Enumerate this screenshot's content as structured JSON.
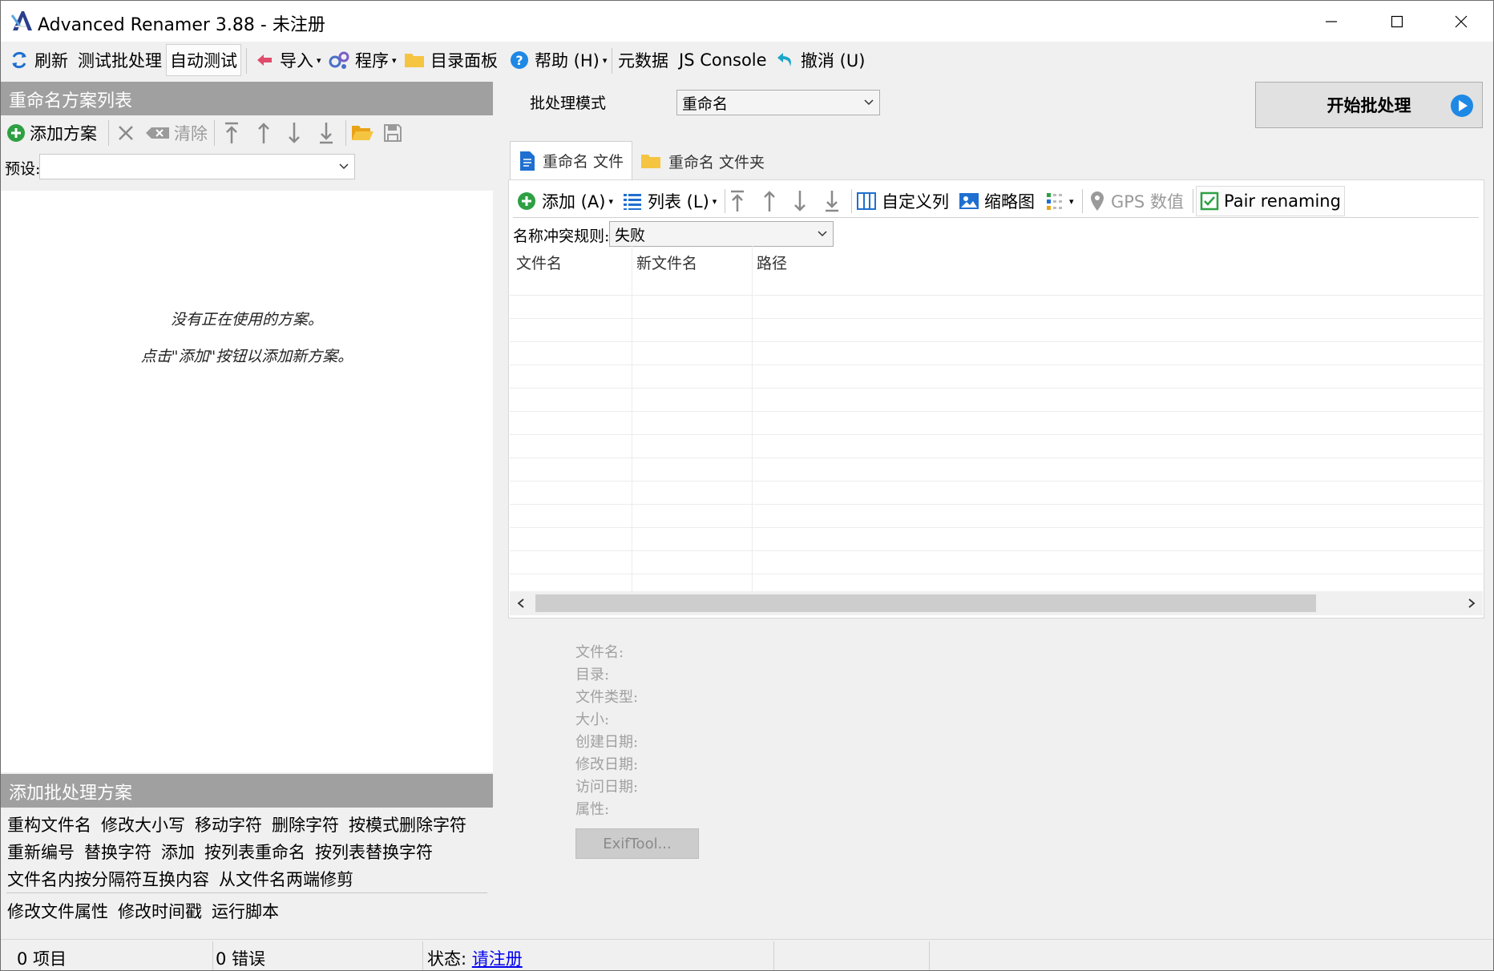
{
  "window": {
    "title": "Advanced Renamer 3.88 - 未注册"
  },
  "toolbar": {
    "refresh": "刷新",
    "test_batch": "测试批处理",
    "auto_test": "自动测试",
    "import": "导入",
    "program": "程序",
    "dir_panel": "目录面板",
    "help": "帮助 (H)",
    "metadata": "元数据",
    "js_console": "JS Console",
    "undo": "撤消 (U)"
  },
  "left": {
    "method_list_header": "重命名方案列表",
    "add_method": "添加方案",
    "clear": "清除",
    "preset_label": "预设:",
    "preset_value": "",
    "empty_line1": "没有正在使用的方案。",
    "empty_line2": "点击\"添加\"按钮以添加新方案。",
    "add_batch_header": "添加批处理方案",
    "methods_row1": [
      "重构文件名",
      "修改大小写",
      "移动字符",
      "删除字符",
      "按模式删除字符"
    ],
    "methods_row2": [
      "重新编号",
      "替换字符",
      "添加",
      "按列表重命名",
      "按列表替换字符"
    ],
    "methods_row3": [
      "文件名内按分隔符互换内容",
      "从文件名两端修剪"
    ],
    "methods_row4": [
      "修改文件属性",
      "修改时间戳",
      "运行脚本"
    ]
  },
  "batch": {
    "mode_label": "批处理模式",
    "mode_value": "重命名",
    "start_button": "开始批处理"
  },
  "tabs": {
    "files": "重命名 文件",
    "folders": "重命名 文件夹"
  },
  "files_toolbar": {
    "add": "添加 (A)",
    "list": "列表 (L)",
    "custom_columns": "自定义列",
    "thumbnail": "缩略图",
    "gps": "GPS 数值",
    "pair_renaming": "Pair renaming"
  },
  "conflict": {
    "label": "名称冲突规则:",
    "value": "失败"
  },
  "columns": [
    "文件名",
    "新文件名",
    "路径"
  ],
  "file_info": {
    "filename": "文件名:",
    "directory": "目录:",
    "filetype": "文件类型:",
    "size": "大小:",
    "created": "创建日期:",
    "modified": "修改日期:",
    "accessed": "访问日期:",
    "attributes": "属性:",
    "exiftool": "ExifTool..."
  },
  "status": {
    "items": "0 项目",
    "errors": "0 错误",
    "state_label": "状态:",
    "register_link": "请注册"
  },
  "colors": {
    "accent_blue": "#1e88e5",
    "add_green": "#2ea043",
    "header_gray": "#a0a0a0",
    "folder_yellow": "#f5c542"
  }
}
